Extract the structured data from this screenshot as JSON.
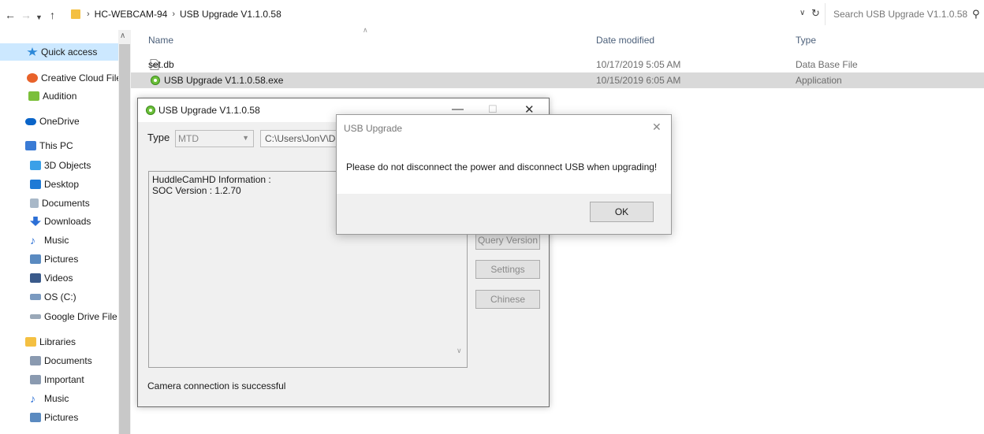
{
  "addressbar": {
    "crumbs": [
      "HC-WEBCAM-94",
      "USB Upgrade V1.1.0.58"
    ],
    "search_placeholder": "Search USB Upgrade V1.1.0.58"
  },
  "navpane": {
    "items": [
      {
        "label": "Quick access",
        "icon": "star-icon",
        "color": "#2b88d8"
      },
      {
        "label": "Creative Cloud Files",
        "icon": "creative-cloud-icon",
        "color": "#e8622a"
      },
      {
        "label": "Audition",
        "icon": "audition-icon",
        "color": "#7bbf3a"
      },
      {
        "label": "OneDrive",
        "icon": "cloud-icon",
        "color": "#0a64c8"
      },
      {
        "label": "This PC",
        "icon": "computer-icon",
        "color": "#3a7bd5"
      },
      {
        "label": "3D Objects",
        "icon": "cube-icon",
        "color": "#3aa0e8"
      },
      {
        "label": "Desktop",
        "icon": "desktop-icon",
        "color": "#1e7ad6"
      },
      {
        "label": "Documents",
        "icon": "document-icon",
        "color": "#a8b8c8"
      },
      {
        "label": "Downloads",
        "icon": "download-icon",
        "color": "#2b6fd6"
      },
      {
        "label": "Music",
        "icon": "music-icon",
        "color": "#2b6fd6"
      },
      {
        "label": "Pictures",
        "icon": "pictures-icon",
        "color": "#5a8ac0"
      },
      {
        "label": "Videos",
        "icon": "video-icon",
        "color": "#3a5a8a"
      },
      {
        "label": "OS (C:)",
        "icon": "drive-icon",
        "color": "#7a9ac0"
      },
      {
        "label": "Google Drive File",
        "icon": "drive-icon",
        "color": "#9aa8b8"
      },
      {
        "label": "Libraries",
        "icon": "folder-icon",
        "color": "#f4c042"
      },
      {
        "label": "Documents",
        "icon": "document-icon",
        "color": "#8a9ab0"
      },
      {
        "label": "Important",
        "icon": "document-icon",
        "color": "#8a9ab0"
      },
      {
        "label": "Music",
        "icon": "music-icon",
        "color": "#2b6fd6"
      },
      {
        "label": "Pictures",
        "icon": "pictures-icon",
        "color": "#5a8ac0"
      }
    ]
  },
  "filelist": {
    "headers": {
      "name": "Name",
      "date": "Date modified",
      "type": "Type"
    },
    "rows": [
      {
        "name": "set.db",
        "date": "10/17/2019 5:05 AM",
        "type": "Data Base File",
        "icon": "file-icon"
      },
      {
        "name": "USB Upgrade V1.1.0.58.exe",
        "date": "10/15/2019 6:05 AM",
        "type": "Application",
        "icon": "gear-icon"
      }
    ]
  },
  "app": {
    "title": "USB Upgrade V1.1.0.58",
    "type_label": "Type",
    "type_value": "MTD",
    "path_value": "C:\\Users\\JonV\\Desktop",
    "info_text": "HuddleCamHD Information :\nSOC Version : 1.2.70",
    "buttons": {
      "query": "Query Version",
      "settings": "Settings",
      "chinese": "Chinese"
    },
    "status": "Camera connection is successful"
  },
  "dialog": {
    "title": "USB Upgrade",
    "message": "Please do not disconnect the power and disconnect USB when upgrading!",
    "ok_label": "OK"
  }
}
